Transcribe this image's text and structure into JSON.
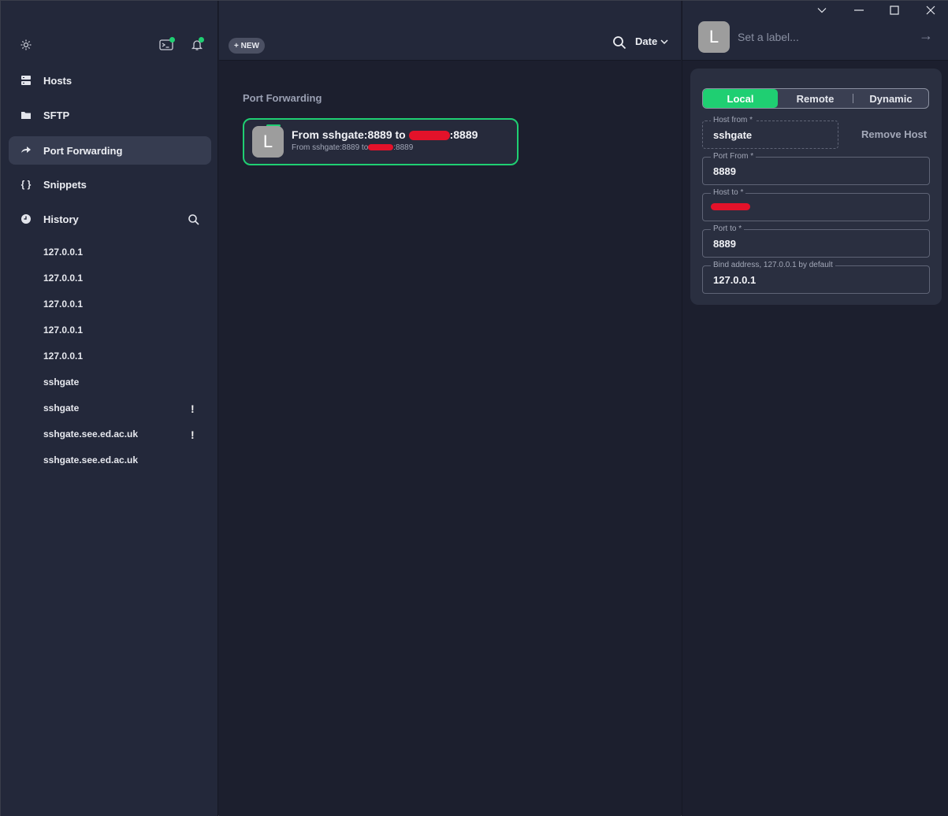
{
  "sidebar": {
    "nav": [
      {
        "label": "Hosts",
        "icon": "hosts-icon"
      },
      {
        "label": "SFTP",
        "icon": "folder-icon"
      },
      {
        "label": "Port Forwarding",
        "icon": "port-forwarding-icon"
      },
      {
        "label": "Snippets",
        "icon": "braces-icon"
      },
      {
        "label": "History",
        "icon": "history-clock-icon"
      }
    ],
    "history": [
      {
        "label": "127.0.0.1",
        "warning": ""
      },
      {
        "label": "127.0.0.1",
        "warning": ""
      },
      {
        "label": "127.0.0.1",
        "warning": ""
      },
      {
        "label": "127.0.0.1",
        "warning": ""
      },
      {
        "label": "127.0.0.1",
        "warning": ""
      },
      {
        "label": "sshgate",
        "warning": ""
      },
      {
        "label": "sshgate",
        "warning": "!"
      },
      {
        "label": "sshgate.see.ed.ac.uk",
        "warning": "!"
      },
      {
        "label": "sshgate.see.ed.ac.uk",
        "warning": ""
      }
    ]
  },
  "toolbar": {
    "new_label": "+ NEW",
    "sort_label": "Date"
  },
  "main": {
    "section_title": "Port Forwarding",
    "card": {
      "avatar_letter": "L",
      "title_prefix": "From sshgate:8889 to",
      "title_suffix": ":8889",
      "sub_prefix": "From sshgate:8889 to",
      "sub_suffix": ":8889"
    }
  },
  "editor": {
    "avatar_letter": "L",
    "label_placeholder": "Set a label...",
    "tabs": [
      "Local",
      "Remote",
      "Dynamic"
    ],
    "active_tab": "Local",
    "remove_host_label": "Remove Host",
    "fields": {
      "host_from": {
        "label": "Host from *",
        "value": "sshgate"
      },
      "port_from": {
        "label": "Port From *",
        "value": "8889"
      },
      "host_to": {
        "label": "Host to *",
        "value": ""
      },
      "port_to": {
        "label": "Port to *",
        "value": "8889"
      },
      "bind_address": {
        "label": "Bind address, 127.0.0.1 by default",
        "value": "127.0.0.1"
      }
    }
  },
  "colors": {
    "accent": "#1fcf72",
    "sidebar_bg": "#23283a",
    "main_bg": "#1c1f2e",
    "redaction": "#e3122a"
  }
}
